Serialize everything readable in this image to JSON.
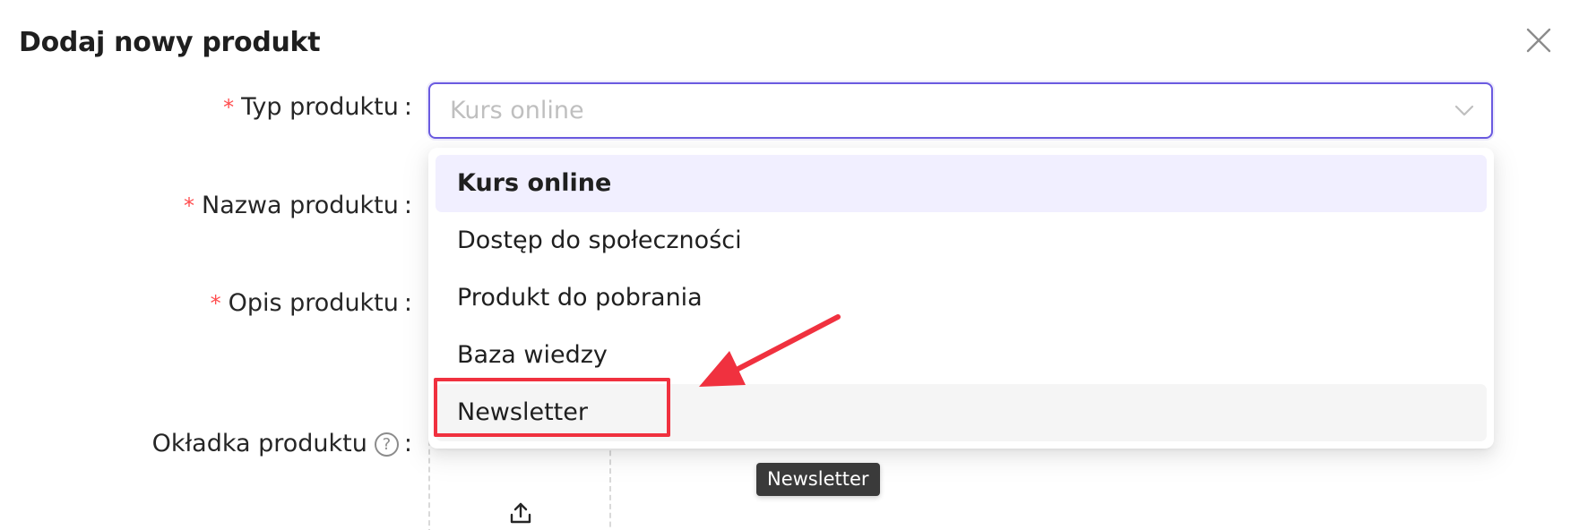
{
  "modal": {
    "title": "Dodaj nowy produkt"
  },
  "form": {
    "product_type": {
      "label": "Typ produktu",
      "placeholder": "Kurs online"
    },
    "product_name": {
      "label": "Nazwa produktu"
    },
    "product_description": {
      "label": "Opis produktu"
    },
    "product_cover": {
      "label": "Okładka produktu"
    },
    "required_mark": "*",
    "colon": ":",
    "help_glyph": "?"
  },
  "dropdown": {
    "options": [
      {
        "label": "Kurs online",
        "state": "selected"
      },
      {
        "label": "Dostęp do społeczności",
        "state": "default"
      },
      {
        "label": "Produkt do pobrania",
        "state": "default"
      },
      {
        "label": "Baza wiedzy",
        "state": "default"
      },
      {
        "label": "Newsletter",
        "state": "hover"
      }
    ]
  },
  "tooltip": {
    "text": "Newsletter"
  },
  "icons": {
    "close": "close-icon",
    "chevron": "chevron-down-icon",
    "help": "question-circle-icon",
    "upload": "upload-icon"
  },
  "colors": {
    "accent": "#6a5ae0",
    "required": "#ff4d4f",
    "annotation": "#f0313f",
    "selected_bg": "#f1efff",
    "hover_bg": "#f5f5f5",
    "tooltip_bg": "#3a3a3a"
  }
}
